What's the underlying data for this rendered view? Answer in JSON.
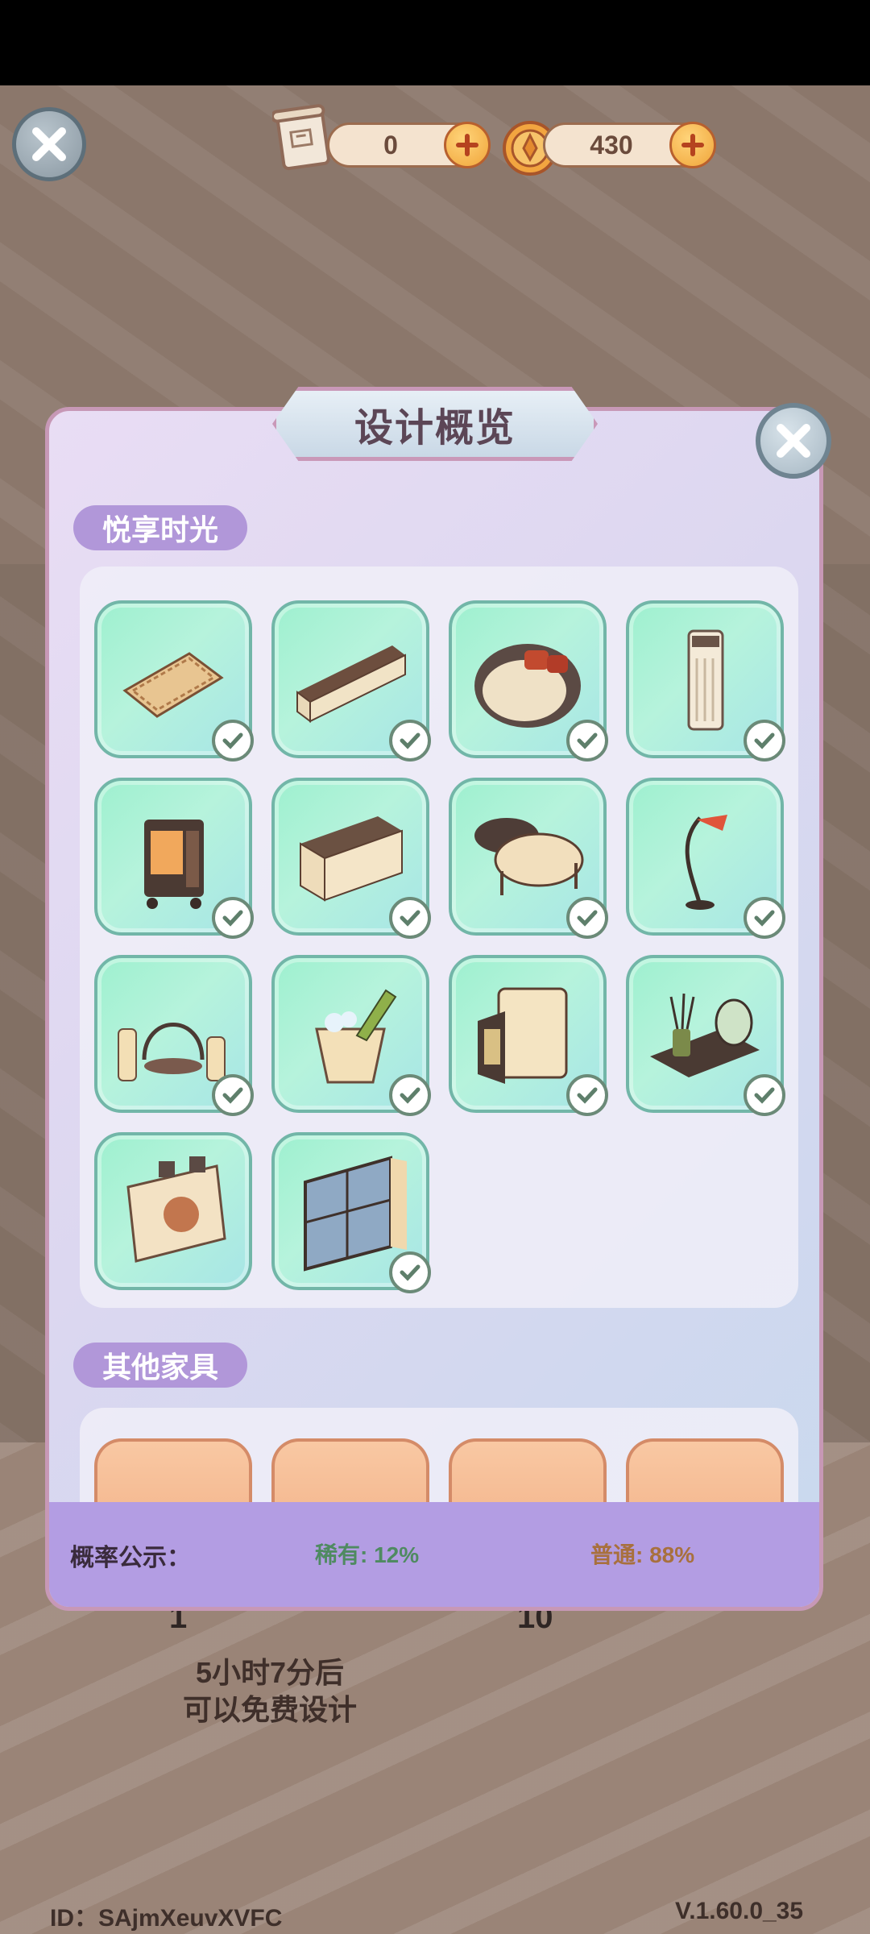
{
  "header": {
    "scroll_count": "0",
    "coin_count": "430",
    "accent_plus": "#f0a53a"
  },
  "background": {
    "free_design_line1": "5小时7分后",
    "free_design_line2": "可以免费设计",
    "left_badge": "1",
    "right_badge": "10"
  },
  "modal": {
    "title": "设计概览",
    "section1": {
      "label": "悦享时光",
      "items": [
        {
          "name": "geometric-rug",
          "owned": true
        },
        {
          "name": "tv-stand",
          "owned": true
        },
        {
          "name": "round-sofa-bed",
          "owned": true
        },
        {
          "name": "air-purifier",
          "owned": true
        },
        {
          "name": "fireplace-cart",
          "owned": true
        },
        {
          "name": "sideboard-cabinet",
          "owned": true
        },
        {
          "name": "round-coffee-tables",
          "owned": true
        },
        {
          "name": "arc-floor-lamp",
          "owned": true
        },
        {
          "name": "candle-lantern-set",
          "owned": true
        },
        {
          "name": "champagne-bucket",
          "owned": true
        },
        {
          "name": "mini-fridge",
          "owned": true
        },
        {
          "name": "diffuser-tray",
          "owned": true
        },
        {
          "name": "anime-poster-board",
          "owned": false
        },
        {
          "name": "window-with-curtain",
          "owned": true
        }
      ]
    },
    "section2": {
      "label": "其他家具",
      "items": [
        {
          "name": "other-furniture-1"
        },
        {
          "name": "other-furniture-2"
        },
        {
          "name": "other-furniture-3"
        },
        {
          "name": "other-furniture-4"
        }
      ]
    },
    "probability": {
      "label": "概率公示：",
      "rare": "稀有: 12%",
      "common": "普通: 88%",
      "rare_color": "#4f8a61",
      "common_color": "#a8703d"
    }
  },
  "footer": {
    "id_text": "ID：SAjmXeuvXVFC",
    "version": "V.1.60.0_35"
  }
}
